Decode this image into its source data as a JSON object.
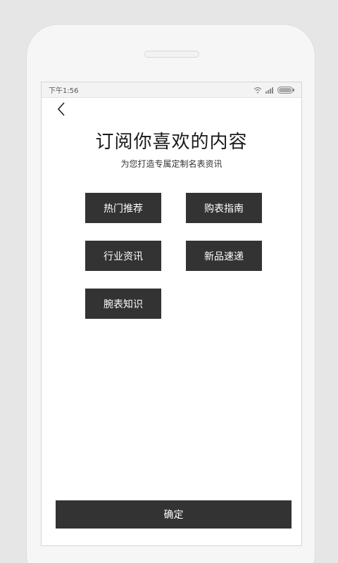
{
  "status": {
    "time": "下午1:56",
    "icons": [
      "wifi-icon",
      "signal-icon",
      "battery-icon"
    ]
  },
  "nav": {
    "back_icon": "chevron-left-icon"
  },
  "header": {
    "title": "订阅你喜欢的内容",
    "subtitle": "为您打造专属定制名表资讯"
  },
  "topics": [
    {
      "label": "热门推荐"
    },
    {
      "label": "购表指南"
    },
    {
      "label": "行业资讯"
    },
    {
      "label": "新品速递"
    },
    {
      "label": "腕表知识"
    }
  ],
  "footer": {
    "confirm_label": "确定"
  },
  "colors": {
    "button_bg": "#333333",
    "button_text": "#ffffff",
    "background": "#e6e6e6",
    "screen": "#ffffff"
  }
}
